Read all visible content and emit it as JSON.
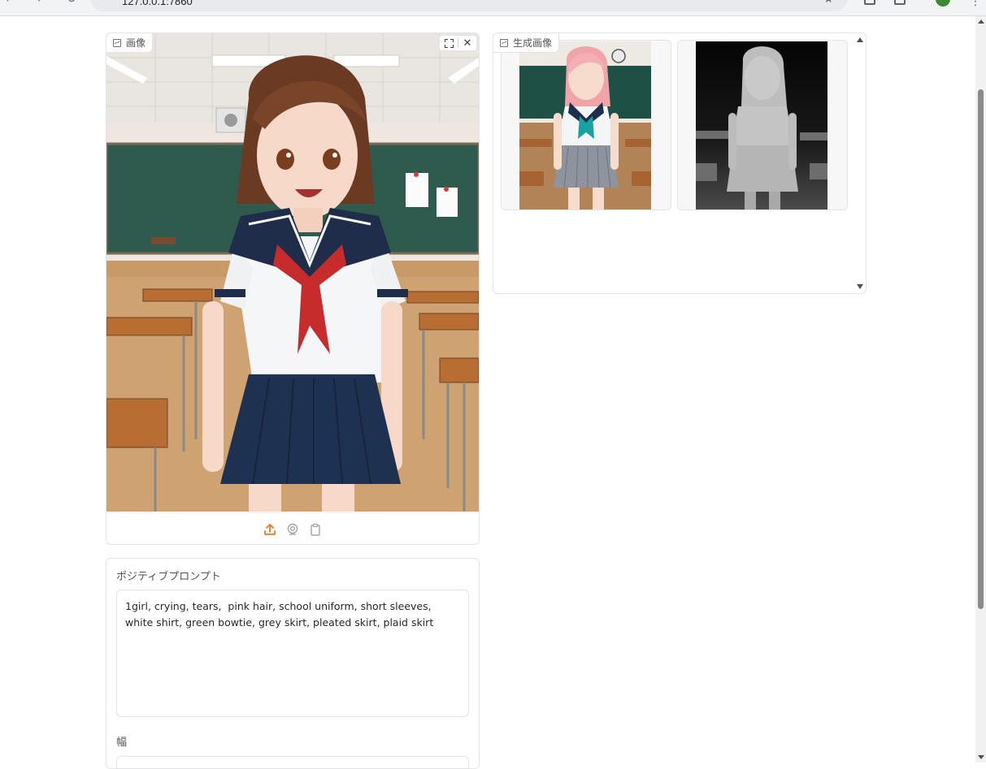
{
  "browser": {
    "url": "127.0.0.1:7860"
  },
  "input_image": {
    "label": "画像"
  },
  "gallery": {
    "label": "生成画像"
  },
  "prompt": {
    "label": "ポジティブプロンプト",
    "value": "1girl, crying, tears,  pink hair, school uniform, short sleeves, white shirt, green bowtie, grey skirt, pleated skirt, plaid skirt"
  },
  "width_field": {
    "label": "幅"
  },
  "colors": {
    "accent": "#f97316",
    "border": "#e4e4e7"
  }
}
